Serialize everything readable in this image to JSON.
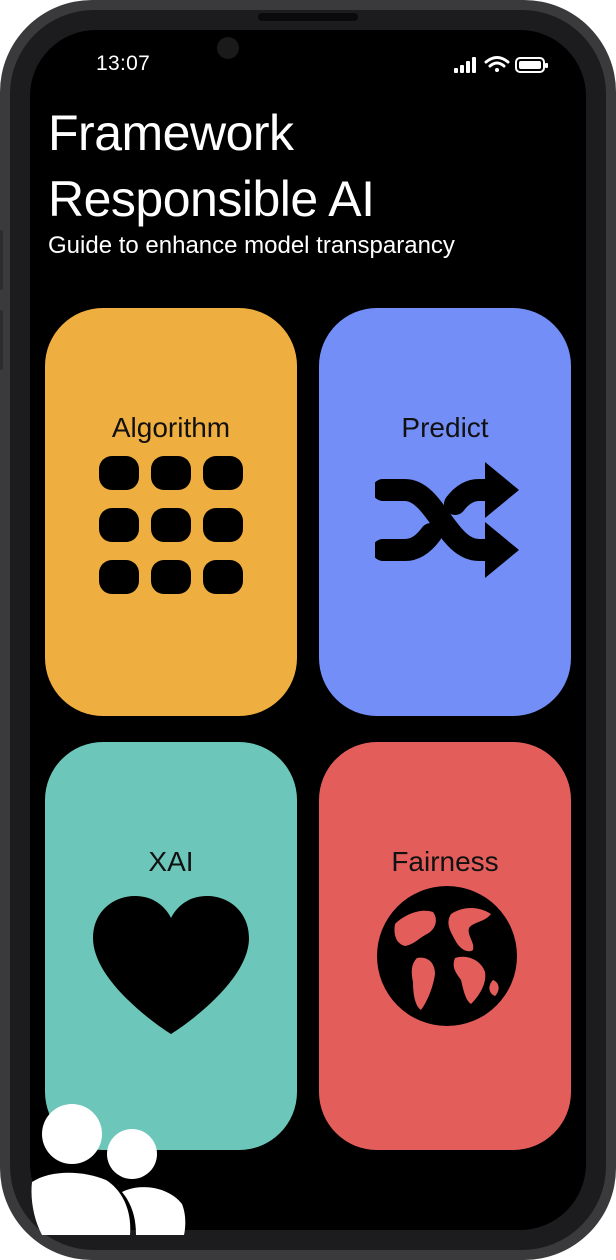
{
  "status_bar": {
    "time": "13:07"
  },
  "header": {
    "title_line_1": "Framework",
    "title_line_2": "Responsible AI",
    "subtitle": "Guide to enhance model transparancy"
  },
  "tiles": [
    {
      "label": "Algorithm",
      "icon": "grid-icon",
      "color": "#EFAE40"
    },
    {
      "label": "Predict",
      "icon": "shuffle-icon",
      "color": "#738EF6"
    },
    {
      "label": "XAI",
      "icon": "heart-icon",
      "color": "#6CC6B9"
    },
    {
      "label": "Fairness",
      "icon": "globe-icon",
      "color": "#E35E5B"
    }
  ],
  "colors": {
    "background": "#000000",
    "frame": "#3A3A3C",
    "text": "#FFFFFF"
  },
  "footer": {
    "icon": "users-icon"
  }
}
